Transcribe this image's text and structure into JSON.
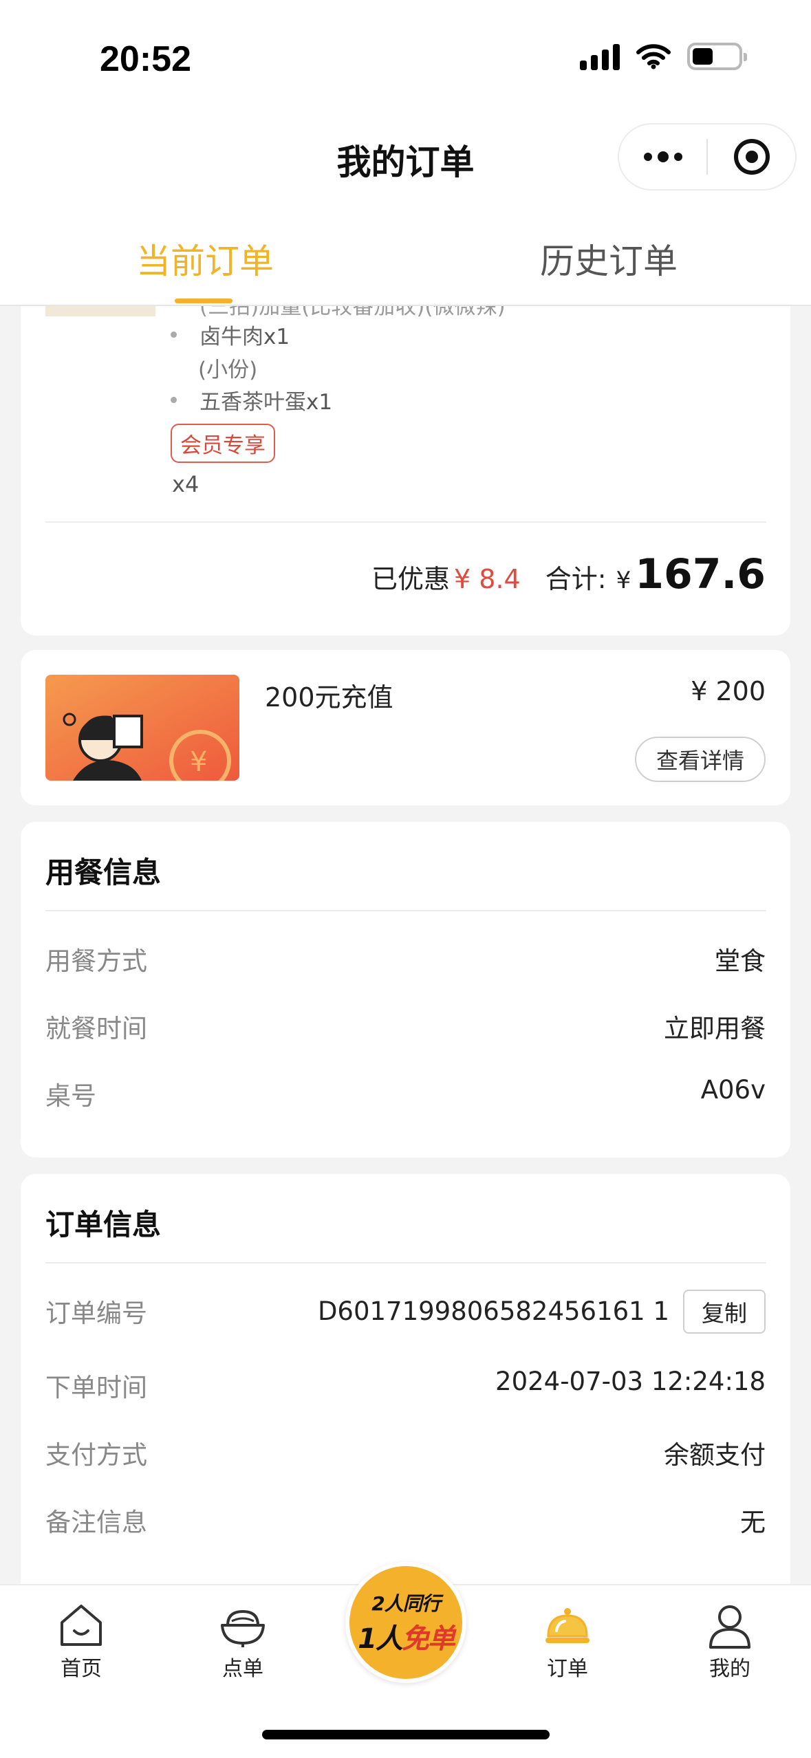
{
  "status_bar": {
    "time": "20:52"
  },
  "header": {
    "title": "我的订单"
  },
  "tabs": [
    {
      "label": "当前订单",
      "active": true
    },
    {
      "label": "历史订单",
      "active": false
    }
  ],
  "order_items": {
    "cut_line": "(三拍)加量(比较番茄收)(微微辣)",
    "items": [
      {
        "name": "卤牛肉",
        "qty": "x1",
        "note": "(小份)"
      },
      {
        "name": "五香茶叶蛋",
        "qty": "x1"
      }
    ],
    "member_tag": "会员专享",
    "count": "x4",
    "summary": {
      "discount_label": "已优惠",
      "discount_value": "¥ 8.4",
      "total_label": "合计:",
      "currency": "¥",
      "total": "167.6"
    }
  },
  "recharge": {
    "name": "200元充值",
    "price": "¥ 200",
    "detail_button": "查看详情"
  },
  "dining_info": {
    "title": "用餐信息",
    "rows": [
      {
        "label": "用餐方式",
        "value": "堂食"
      },
      {
        "label": "就餐时间",
        "value": "立即用餐"
      },
      {
        "label": "桌号",
        "value": "A06v"
      }
    ]
  },
  "order_info": {
    "title": "订单信息",
    "rows": [
      {
        "label": "订单编号",
        "value": "D6017199806582456161 1"
      },
      {
        "label": "下单时间",
        "value": "2024-07-03 12:24:18"
      },
      {
        "label": "支付方式",
        "value": "余额支付"
      },
      {
        "label": "备注信息",
        "value": "无"
      }
    ],
    "copy_button": "复制"
  },
  "bottom_nav": {
    "items": [
      {
        "label": "首页",
        "icon": "home-icon"
      },
      {
        "label": "点单",
        "icon": "bowl-icon"
      },
      {
        "label": "订单",
        "icon": "cloche-icon",
        "active": true
      },
      {
        "label": "我的",
        "icon": "user-icon"
      }
    ],
    "promo": {
      "line1": "2人同行",
      "line2_a": "1人",
      "line2_b": "免单"
    }
  },
  "colors": {
    "accent": "#f3b12c",
    "discount": "#e04b3f",
    "tag": "#d9483b"
  }
}
